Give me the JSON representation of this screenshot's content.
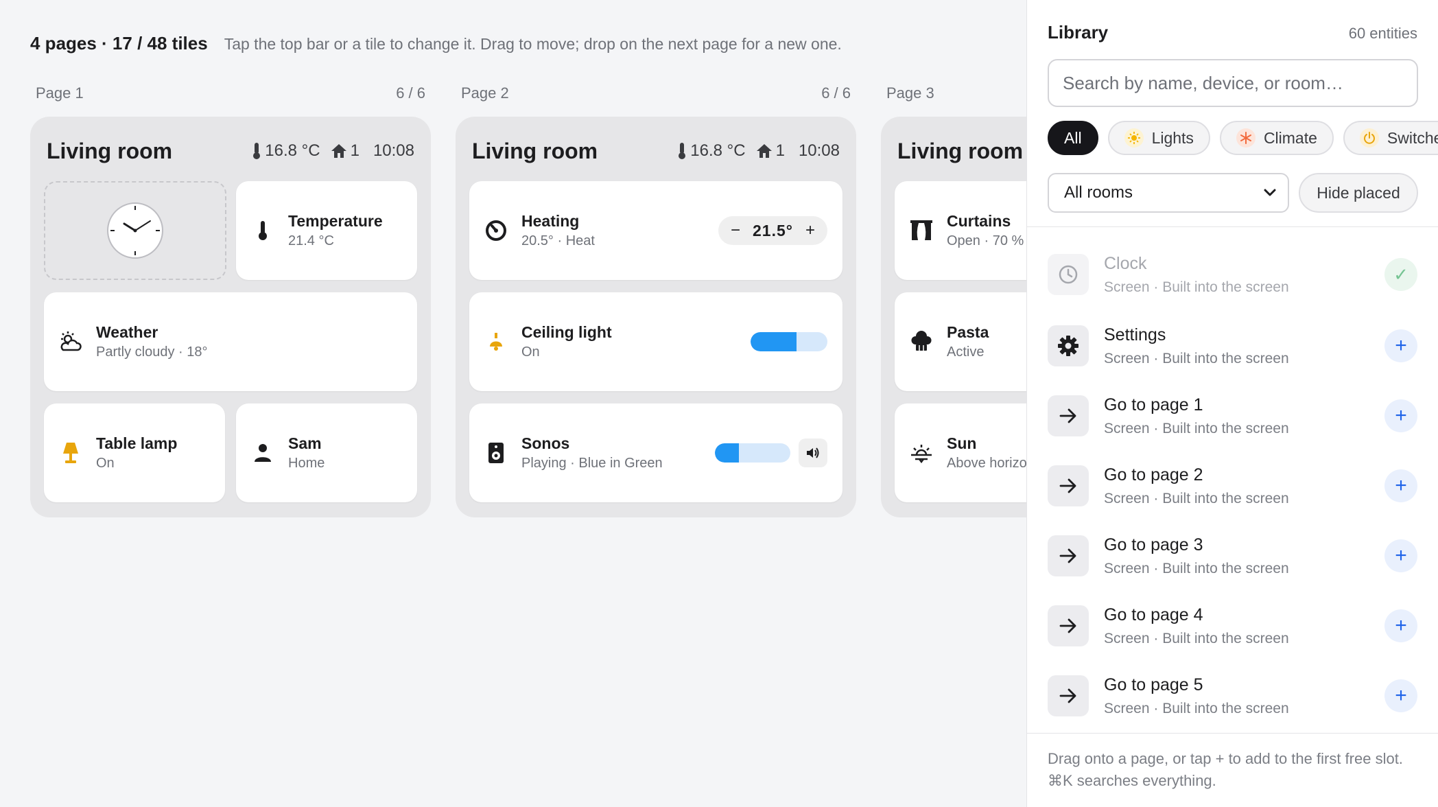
{
  "topbar": {
    "summary": "4 pages · 17 / 48 tiles",
    "hint": "Tap the top bar or a tile to change it. Drag to move; drop on the next page for a new one."
  },
  "pages": [
    {
      "label": "Page 1",
      "count": "6 / 6",
      "title": "Living room",
      "temp": "16.8 °C",
      "home_count": "1",
      "time": "10:08",
      "tiles": {
        "clock": {
          "icon": "clock-icon"
        },
        "temperature": {
          "name": "Temperature",
          "sub": "21.4 °C",
          "icon": "thermometer-icon"
        },
        "weather": {
          "name": "Weather",
          "sub": "Partly cloudy · 18°",
          "icon": "weather-icon"
        },
        "lamp": {
          "name": "Table lamp",
          "sub": "On",
          "icon": "lamp-icon",
          "color": "#e8a50c"
        },
        "person": {
          "name": "Sam",
          "sub": "Home",
          "icon": "person-icon"
        }
      }
    },
    {
      "label": "Page 2",
      "count": "6 / 6",
      "title": "Living room",
      "temp": "16.8 °C",
      "home_count": "1",
      "time": "10:08",
      "tiles": {
        "heating": {
          "name": "Heating",
          "sub": "20.5° · Heat",
          "icon": "heating-icon",
          "setpoint": "21.5°",
          "minus": "−",
          "plus": "+"
        },
        "ceiling": {
          "name": "Ceiling light",
          "sub": "On",
          "icon": "ceiling-light-icon",
          "color": "#e8a50c",
          "level": 0.6
        },
        "sonos": {
          "name": "Sonos",
          "sub": "Playing · Blue in Green",
          "icon": "speaker-icon",
          "volume": 0.32
        }
      }
    },
    {
      "label": "Page 3",
      "title": "Living room",
      "tiles": {
        "curtains": {
          "name": "Curtains",
          "sub": "Open · 70 %",
          "icon": "curtains-icon"
        },
        "pasta": {
          "name": "Pasta",
          "sub": "Active",
          "icon": "chef-hat-icon"
        },
        "sun": {
          "name": "Sun",
          "sub": "Above horizon",
          "icon": "sun-horizon-icon"
        }
      }
    }
  ],
  "library": {
    "title": "Library",
    "count": "60 entities",
    "search_placeholder": "Search by name, device, or room…",
    "chips": [
      {
        "label": "All",
        "active": true
      },
      {
        "label": "Lights",
        "icon": "sun-icon",
        "color": "#f4b400"
      },
      {
        "label": "Climate",
        "icon": "snowflake-icon",
        "color": "#f26a3d"
      },
      {
        "label": "Switches",
        "icon": "power-icon",
        "color": "#e8a50c"
      }
    ],
    "room_filter": "All rooms",
    "hide_placed": "Hide placed",
    "items": [
      {
        "name": "Clock",
        "sub": "Screen · Built into the screen",
        "icon": "clock-icon",
        "placed": true
      },
      {
        "name": "Settings",
        "sub": "Screen · Built into the screen",
        "icon": "gear-icon"
      },
      {
        "name": "Go to page 1",
        "sub": "Screen · Built into the screen",
        "icon": "arrow-right-icon"
      },
      {
        "name": "Go to page 2",
        "sub": "Screen · Built into the screen",
        "icon": "arrow-right-icon"
      },
      {
        "name": "Go to page 3",
        "sub": "Screen · Built into the screen",
        "icon": "arrow-right-icon"
      },
      {
        "name": "Go to page 4",
        "sub": "Screen · Built into the screen",
        "icon": "arrow-right-icon"
      },
      {
        "name": "Go to page 5",
        "sub": "Screen · Built into the screen",
        "icon": "arrow-right-icon"
      }
    ],
    "add_label": "+",
    "check_label": "✓",
    "footer": "Drag onto a page, or tap + to add to the first free slot. ⌘K searches everything."
  }
}
